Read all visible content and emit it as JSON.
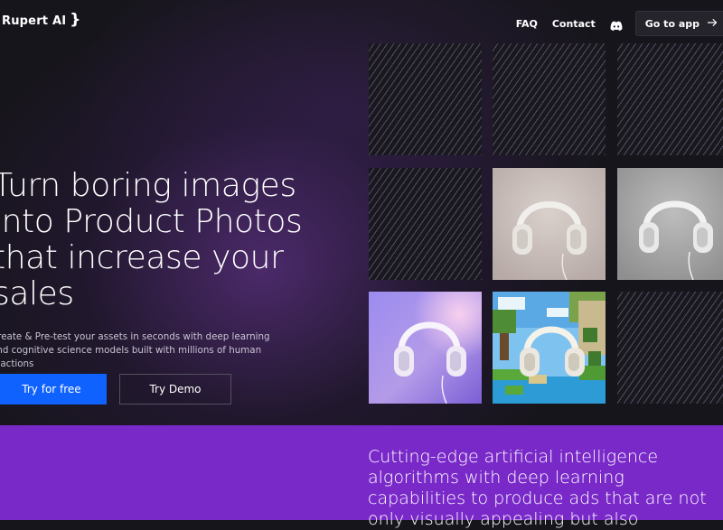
{
  "header": {
    "logo_text": "Rupert AI",
    "logo_brace": "}",
    "nav": {
      "faq": "FAQ",
      "contact": "Contact",
      "discord_icon": "discord-icon",
      "app_button": "Go to app",
      "arrow_icon": "arrow-right-icon"
    }
  },
  "hero": {
    "headline": "Turn boring images into Product Photos that increase your sales",
    "subtext": "Create & Pre-test your assets in seconds with deep learning and cognitive science models built with millions of human reactions",
    "primary_button": "Try for free",
    "secondary_button": "Try Demo"
  },
  "gallery": {
    "tiles": [
      "pattern",
      "pattern",
      "pattern",
      "pattern",
      "headphones-beige",
      "headphones-grey",
      "headphones-purple",
      "headphones-pixel",
      "pattern"
    ]
  },
  "feature": {
    "text": "Cutting-edge artificial intelligence algorithms with deep learning capabilities to produce ads that are not only visually appealing but also"
  },
  "colors": {
    "background": "#17151c",
    "primary_button": "#0f62fe",
    "band": "#7a29c9"
  }
}
